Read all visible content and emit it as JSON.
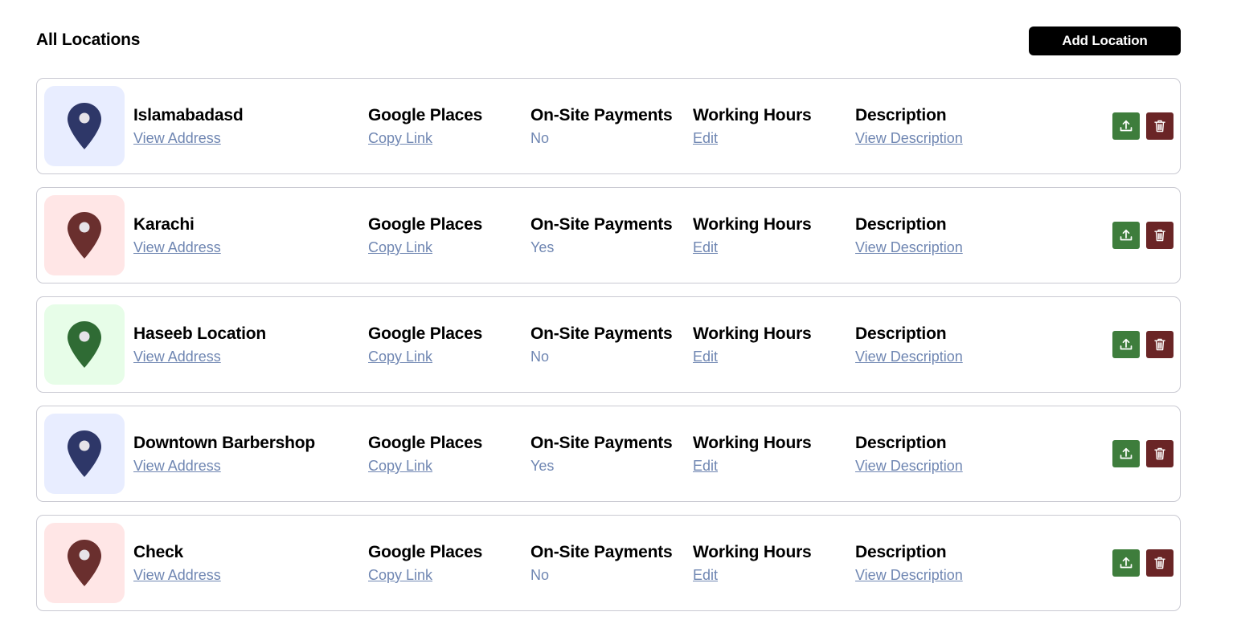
{
  "header": {
    "title": "All Locations",
    "add_button_label": "Add Location"
  },
  "labels": {
    "view_address": "View Address",
    "google_places": "Google Places",
    "copy_link": "Copy Link",
    "on_site_payments": "On-Site Payments",
    "working_hours": "Working Hours",
    "edit": "Edit",
    "description": "Description",
    "view_description": "View Description"
  },
  "colors": {
    "upload_button": "#3e7d3c",
    "delete_button": "#6a2526",
    "link": "#6f86b2"
  },
  "locations": [
    {
      "name": "Islamabadasd",
      "on_site_payments": "No",
      "icon": "location-pin-icon",
      "tile_bg": "#e8edff",
      "pin_color": "#2e3768"
    },
    {
      "name": "Karachi",
      "on_site_payments": "Yes",
      "icon": "location-pin-icon",
      "tile_bg": "#ffe6e6",
      "pin_color": "#6a2f2e"
    },
    {
      "name": "Haseeb Location",
      "on_site_payments": "No",
      "icon": "location-pin-icon",
      "tile_bg": "#e7fde8",
      "pin_color": "#2f6b34"
    },
    {
      "name": "Downtown Barbershop",
      "on_site_payments": "Yes",
      "icon": "location-pin-icon",
      "tile_bg": "#e8edff",
      "pin_color": "#2e3768"
    },
    {
      "name": "Check",
      "on_site_payments": "No",
      "icon": "location-pin-icon",
      "tile_bg": "#ffe6e6",
      "pin_color": "#6a2f2e"
    }
  ]
}
